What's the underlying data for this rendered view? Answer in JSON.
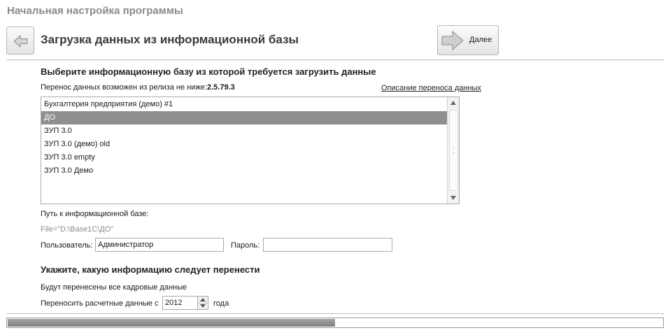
{
  "app_title": "Начальная настройка программы",
  "header": {
    "step_title": "Загрузка данных из информационной базы",
    "next_label": "Далее",
    "back_icon": "arrow-left-icon",
    "next_icon": "arrow-right-icon"
  },
  "source": {
    "heading": "Выберите информационную базу из которой требуется загрузить данные",
    "release_text": "Перенос данных возможен из релиза не ниже:",
    "release_version": "2.5.79.3",
    "description_link": "Описание переноса данных",
    "databases": [
      "Бухгалтерия предприятия (демо) #1",
      "ДО",
      "ЗУП 3.0",
      "ЗУП 3.0 (демо) old",
      "ЗУП 3.0 empty",
      "ЗУП 3.0 Демо"
    ],
    "selected_database": "ДО",
    "path_label": "Путь к информационной базе:",
    "path_value": "File=\"D:\\Base1C\\ДО\"",
    "user_label": "Пользователь:",
    "user_value": "Администратор",
    "password_label": "Пароль:",
    "password_value": ""
  },
  "transfer": {
    "heading": "Укажите, какую информацию следует перенести",
    "staff_note": "Будут перенесены все кадровые данные",
    "payroll_label": "Переносить расчетные данные с",
    "payroll_year": "2012",
    "year_suffix": "года"
  },
  "progress": {
    "fraction": 0.5
  },
  "colors": {
    "selected_row": "#8f8f8f",
    "progress_fill": "#8a8a8a",
    "title_gray": "#8a8a8a"
  }
}
